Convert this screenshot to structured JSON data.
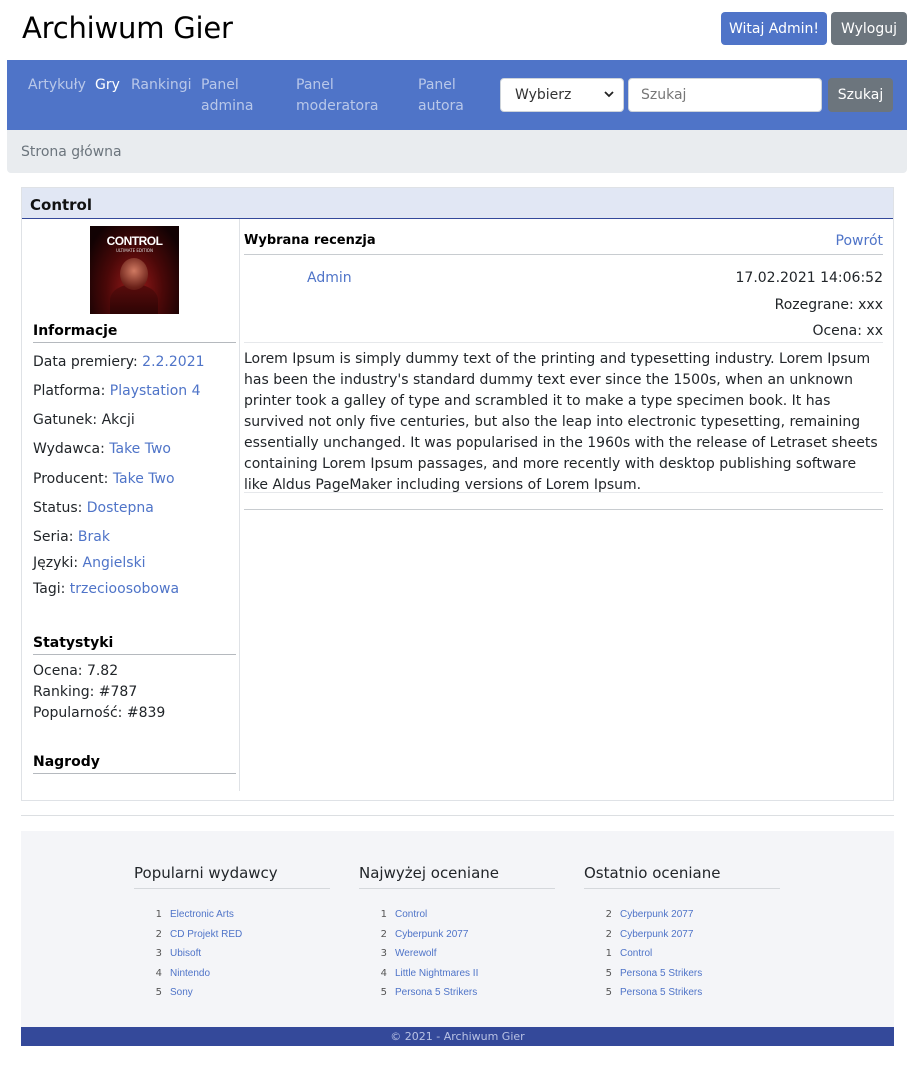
{
  "header": {
    "title": "Archiwum Gier",
    "welcome_button": "Witaj Admin!",
    "logout_button": "Wyloguj"
  },
  "nav": {
    "links": [
      "Artykuły",
      "Gry",
      "Rankingi",
      "Panel admina",
      "Panel moderatora",
      "Panel autora"
    ],
    "active": "Gry",
    "select_value": "Wybierz",
    "search_placeholder": "Szukaj",
    "search_button": "Szukaj"
  },
  "breadcrumb": {
    "home": "Strona główna"
  },
  "game": {
    "title": "Control",
    "cover": {
      "logo": "CONTROL",
      "subtitle": "ULTIMATE EDITION"
    },
    "info_heading": "Informacje",
    "info": [
      {
        "label": "Data premiery:",
        "value": "2.2.2021",
        "link": true
      },
      {
        "label": "Platforma:",
        "value": "Playstation 4",
        "link": true
      },
      {
        "label": "Gatunek:",
        "value": "Akcji",
        "link": false
      },
      {
        "label": "Wydawca:",
        "value": "Take Two",
        "link": true
      },
      {
        "label": "Producent:",
        "value": "Take Two",
        "link": true
      },
      {
        "label": "Status:",
        "value": "Dostepna",
        "link": true
      },
      {
        "label": "Seria:",
        "value": "Brak",
        "link": true
      },
      {
        "label": "Języki:",
        "value": "Angielski",
        "link": true
      },
      {
        "label": "Tagi:",
        "value": "trzecioosobowa",
        "link": true
      }
    ],
    "stats_heading": "Statystyki",
    "stats": [
      "Ocena: 7.82",
      "Ranking: #787",
      "Popularność: #839"
    ],
    "awards_heading": "Nagrody"
  },
  "review": {
    "heading": "Wybrana recenzja",
    "back_link": "Powrót",
    "author": "Admin",
    "date": "17.02.2021 14:06:52",
    "played": "Rozegrane: xxx",
    "rating": "Ocena: xx",
    "body": "Lorem Ipsum is simply dummy text of the printing and typesetting industry. Lorem Ipsum has been the industry's standard dummy text ever since the 1500s, when an unknown printer took a galley of type and scrambled it to make a type specimen book. It has survived not only five centuries, but also the leap into electronic typesetting, remaining essentially unchanged. It was popularised in the 1960s with the release of Letraset sheets containing Lorem Ipsum passages, and more recently with desktop publishing software like Aldus PageMaker including versions of Lorem Ipsum."
  },
  "footer": {
    "columns": [
      {
        "title": "Popularni wydawcy",
        "items": [
          {
            "num": "1",
            "name": "Electronic Arts"
          },
          {
            "num": "2",
            "name": "CD Projekt RED"
          },
          {
            "num": "3",
            "name": "Ubisoft"
          },
          {
            "num": "4",
            "name": "Nintendo"
          },
          {
            "num": "5",
            "name": "Sony"
          }
        ]
      },
      {
        "title": "Najwyżej oceniane",
        "items": [
          {
            "num": "1",
            "name": "Control"
          },
          {
            "num": "2",
            "name": "Cyberpunk 2077"
          },
          {
            "num": "3",
            "name": "Werewolf"
          },
          {
            "num": "4",
            "name": "Little Nightmares II"
          },
          {
            "num": "5",
            "name": "Persona 5 Strikers"
          }
        ]
      },
      {
        "title": "Ostatnio oceniane",
        "items": [
          {
            "num": "2",
            "name": "Cyberpunk 2077"
          },
          {
            "num": "2",
            "name": "Cyberpunk 2077"
          },
          {
            "num": "1",
            "name": "Control"
          },
          {
            "num": "5",
            "name": "Persona 5 Strikers"
          },
          {
            "num": "5",
            "name": "Persona 5 Strikers"
          }
        ]
      }
    ],
    "copyright": "© 2021 - Archiwum Gier"
  }
}
